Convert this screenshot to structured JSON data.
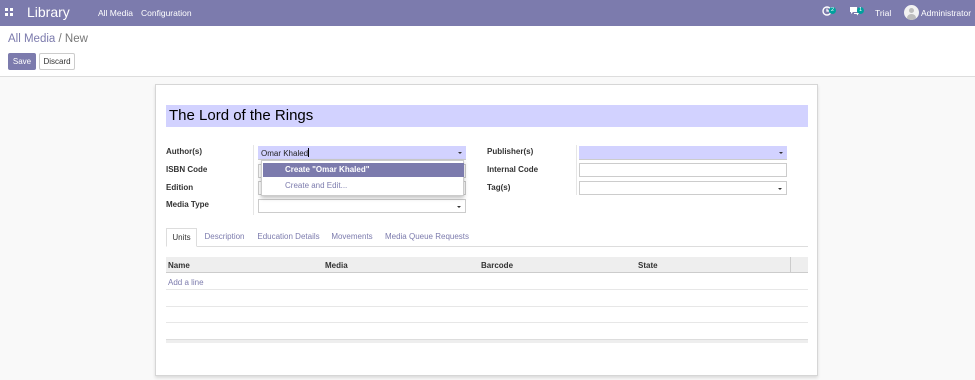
{
  "navbar": {
    "app_title": "Library",
    "menu": [
      "All Media",
      "Configuration"
    ],
    "activity_count": "2",
    "messages_count": "1",
    "trial_label": "Trial",
    "user_name": "Administrator",
    "accent_color": "#7c7bad"
  },
  "control_panel": {
    "breadcrumb_parent": "All Media",
    "breadcrumb_separator": "/",
    "breadcrumb_current": "New",
    "save_label": "Save",
    "discard_label": "Discard"
  },
  "form": {
    "title_value": "The Lord of the Rings",
    "left_fields": {
      "authors_label": "Author(s)",
      "authors_value": "Omar Khaled",
      "isbn_label": "ISBN Code",
      "edition_label": "Edition",
      "media_type_label": "Media Type"
    },
    "right_fields": {
      "publishers_label": "Publisher(s)",
      "internal_code_label": "Internal Code",
      "tags_label": "Tag(s)"
    },
    "autocomplete": {
      "create_label": "Create \"Omar Khaled\"",
      "create_edit_label": "Create and Edit..."
    },
    "tabs": [
      "Units",
      "Description",
      "Education Details",
      "Movements",
      "Media Queue Requests"
    ],
    "active_tab": "Units",
    "table": {
      "columns": [
        "Name",
        "Media",
        "Barcode",
        "State"
      ],
      "add_line_label": "Add a line"
    }
  }
}
